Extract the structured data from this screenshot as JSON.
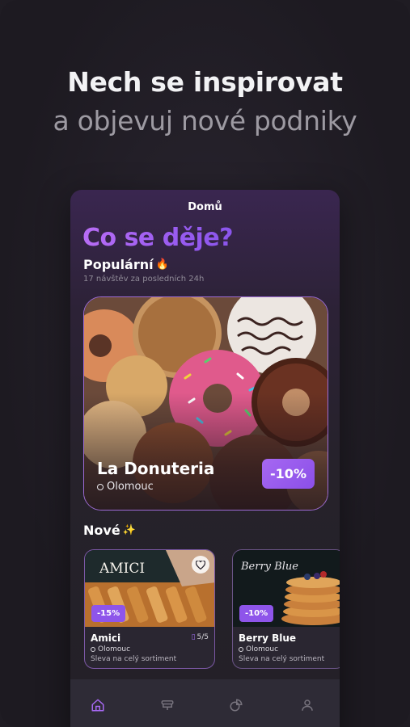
{
  "promo": {
    "headline": "Nech se inspirovat",
    "subline": "a objevuj nové podniky"
  },
  "app": {
    "screen_title": "Domů",
    "hero_title": "Co se děje?",
    "popular": {
      "title": "Populární",
      "emoji": "🔥",
      "subtitle": "17 návštěv za posledních 24h"
    },
    "featured": {
      "name": "La Donuteria",
      "location": "Olomouc",
      "discount": "-10%"
    },
    "new_section": {
      "title": "Nové",
      "emoji": "✨"
    },
    "cards": [
      {
        "name": "Amici",
        "location": "Olomouc",
        "description": "Sleva na celý sortiment",
        "discount": "-15%",
        "count": "5/5",
        "image_text": "AMICI"
      },
      {
        "name": "Berry Blue",
        "location": "Olomouc",
        "description": "Sleva na celý sortiment",
        "discount": "-10%",
        "image_text": "Berry Blue"
      }
    ],
    "tabbar": {
      "items": [
        "home-icon",
        "dish-icon",
        "pie-chart-icon",
        "user-icon"
      ],
      "active": 0,
      "accent": "#a668f2"
    }
  },
  "colors": {
    "accent": "#9a5cf0",
    "background": "#1f1c23"
  }
}
